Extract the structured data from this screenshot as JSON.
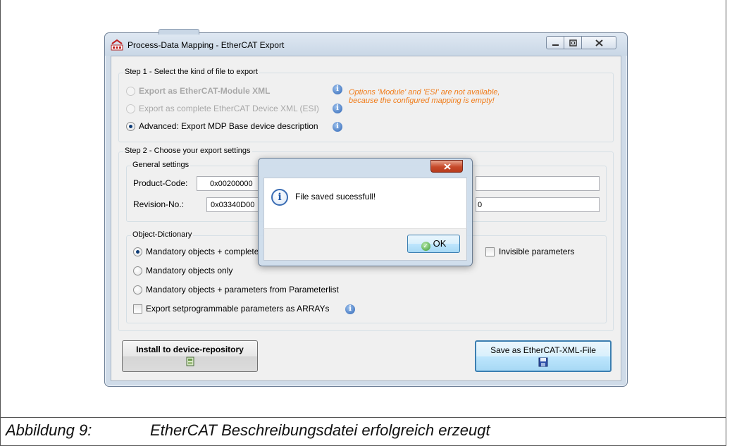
{
  "window": {
    "title": "Process-Data Mapping - EtherCAT Export"
  },
  "step1": {
    "label": "Step 1 - Select the kind of file to export",
    "options": [
      {
        "label": "Export as EtherCAT-Module XML",
        "enabled": false,
        "selected": false
      },
      {
        "label": "Export as complete EtherCAT Device XML (ESI)",
        "enabled": false,
        "selected": false
      },
      {
        "label": "Advanced: Export MDP Base device description",
        "enabled": true,
        "selected": true
      }
    ],
    "warning_line1": "Options 'Module' and 'ESI' are not available,",
    "warning_line2": "because the configured mapping is empty!"
  },
  "step2": {
    "label": "Step 2 - Choose your export settings",
    "general": {
      "label": "General settings",
      "product_code_label": "Product-Code:",
      "product_code_value": "0x00200000",
      "revision_label": "Revision-No.:",
      "revision_value": "0x03340D00",
      "revision_right_fragment": "0"
    },
    "object_dictionary": {
      "label": "Object-Dictionary",
      "options": [
        {
          "label": "Mandatory objects + complete",
          "selected": true
        },
        {
          "label": "Mandatory objects only",
          "selected": false
        },
        {
          "label": "Mandatory objects + parameters from Parameterlist",
          "selected": false
        }
      ],
      "invisible_label": "Invisible parameters",
      "export_arrays_label": "Export setprogrammable parameters as ARRAYs"
    }
  },
  "buttons": {
    "install": "Install to device-repository",
    "save": "Save as EtherCAT-XML-File"
  },
  "dialog": {
    "message": "File saved sucessfull!",
    "ok": "OK"
  },
  "caption": {
    "label": "Abbildung 9:",
    "text": "EtherCAT Beschreibungsdatei erfolgreich erzeugt"
  },
  "colors": {
    "warning": "#f07c1a",
    "window_frame": "#cfdbe8",
    "accent_blue": "#3c7fb1"
  }
}
